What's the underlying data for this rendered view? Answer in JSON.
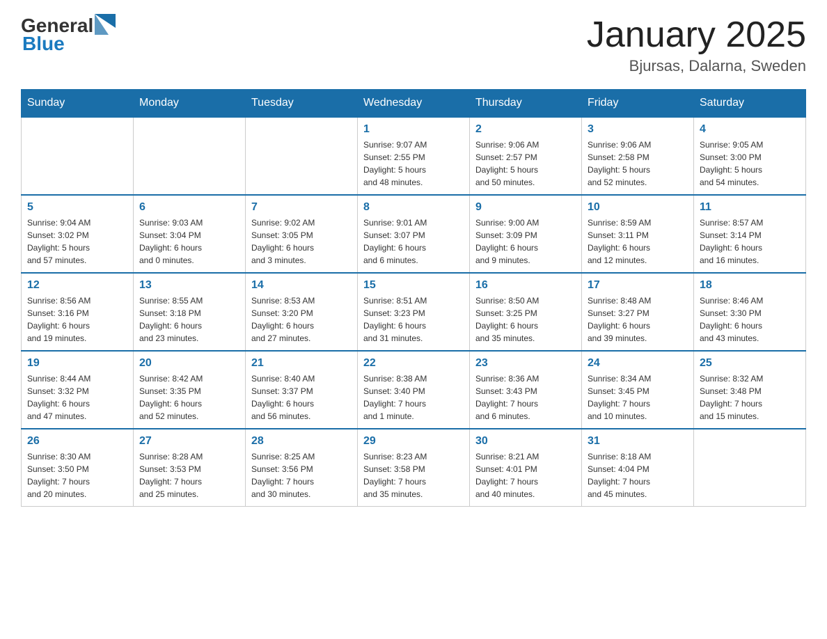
{
  "header": {
    "logo_general": "General",
    "logo_blue": "Blue",
    "title": "January 2025",
    "subtitle": "Bjursas, Dalarna, Sweden"
  },
  "weekdays": [
    "Sunday",
    "Monday",
    "Tuesday",
    "Wednesday",
    "Thursday",
    "Friday",
    "Saturday"
  ],
  "weeks": [
    [
      {
        "day": "",
        "info": ""
      },
      {
        "day": "",
        "info": ""
      },
      {
        "day": "",
        "info": ""
      },
      {
        "day": "1",
        "info": "Sunrise: 9:07 AM\nSunset: 2:55 PM\nDaylight: 5 hours\nand 48 minutes."
      },
      {
        "day": "2",
        "info": "Sunrise: 9:06 AM\nSunset: 2:57 PM\nDaylight: 5 hours\nand 50 minutes."
      },
      {
        "day": "3",
        "info": "Sunrise: 9:06 AM\nSunset: 2:58 PM\nDaylight: 5 hours\nand 52 minutes."
      },
      {
        "day": "4",
        "info": "Sunrise: 9:05 AM\nSunset: 3:00 PM\nDaylight: 5 hours\nand 54 minutes."
      }
    ],
    [
      {
        "day": "5",
        "info": "Sunrise: 9:04 AM\nSunset: 3:02 PM\nDaylight: 5 hours\nand 57 minutes."
      },
      {
        "day": "6",
        "info": "Sunrise: 9:03 AM\nSunset: 3:04 PM\nDaylight: 6 hours\nand 0 minutes."
      },
      {
        "day": "7",
        "info": "Sunrise: 9:02 AM\nSunset: 3:05 PM\nDaylight: 6 hours\nand 3 minutes."
      },
      {
        "day": "8",
        "info": "Sunrise: 9:01 AM\nSunset: 3:07 PM\nDaylight: 6 hours\nand 6 minutes."
      },
      {
        "day": "9",
        "info": "Sunrise: 9:00 AM\nSunset: 3:09 PM\nDaylight: 6 hours\nand 9 minutes."
      },
      {
        "day": "10",
        "info": "Sunrise: 8:59 AM\nSunset: 3:11 PM\nDaylight: 6 hours\nand 12 minutes."
      },
      {
        "day": "11",
        "info": "Sunrise: 8:57 AM\nSunset: 3:14 PM\nDaylight: 6 hours\nand 16 minutes."
      }
    ],
    [
      {
        "day": "12",
        "info": "Sunrise: 8:56 AM\nSunset: 3:16 PM\nDaylight: 6 hours\nand 19 minutes."
      },
      {
        "day": "13",
        "info": "Sunrise: 8:55 AM\nSunset: 3:18 PM\nDaylight: 6 hours\nand 23 minutes."
      },
      {
        "day": "14",
        "info": "Sunrise: 8:53 AM\nSunset: 3:20 PM\nDaylight: 6 hours\nand 27 minutes."
      },
      {
        "day": "15",
        "info": "Sunrise: 8:51 AM\nSunset: 3:23 PM\nDaylight: 6 hours\nand 31 minutes."
      },
      {
        "day": "16",
        "info": "Sunrise: 8:50 AM\nSunset: 3:25 PM\nDaylight: 6 hours\nand 35 minutes."
      },
      {
        "day": "17",
        "info": "Sunrise: 8:48 AM\nSunset: 3:27 PM\nDaylight: 6 hours\nand 39 minutes."
      },
      {
        "day": "18",
        "info": "Sunrise: 8:46 AM\nSunset: 3:30 PM\nDaylight: 6 hours\nand 43 minutes."
      }
    ],
    [
      {
        "day": "19",
        "info": "Sunrise: 8:44 AM\nSunset: 3:32 PM\nDaylight: 6 hours\nand 47 minutes."
      },
      {
        "day": "20",
        "info": "Sunrise: 8:42 AM\nSunset: 3:35 PM\nDaylight: 6 hours\nand 52 minutes."
      },
      {
        "day": "21",
        "info": "Sunrise: 8:40 AM\nSunset: 3:37 PM\nDaylight: 6 hours\nand 56 minutes."
      },
      {
        "day": "22",
        "info": "Sunrise: 8:38 AM\nSunset: 3:40 PM\nDaylight: 7 hours\nand 1 minute."
      },
      {
        "day": "23",
        "info": "Sunrise: 8:36 AM\nSunset: 3:43 PM\nDaylight: 7 hours\nand 6 minutes."
      },
      {
        "day": "24",
        "info": "Sunrise: 8:34 AM\nSunset: 3:45 PM\nDaylight: 7 hours\nand 10 minutes."
      },
      {
        "day": "25",
        "info": "Sunrise: 8:32 AM\nSunset: 3:48 PM\nDaylight: 7 hours\nand 15 minutes."
      }
    ],
    [
      {
        "day": "26",
        "info": "Sunrise: 8:30 AM\nSunset: 3:50 PM\nDaylight: 7 hours\nand 20 minutes."
      },
      {
        "day": "27",
        "info": "Sunrise: 8:28 AM\nSunset: 3:53 PM\nDaylight: 7 hours\nand 25 minutes."
      },
      {
        "day": "28",
        "info": "Sunrise: 8:25 AM\nSunset: 3:56 PM\nDaylight: 7 hours\nand 30 minutes."
      },
      {
        "day": "29",
        "info": "Sunrise: 8:23 AM\nSunset: 3:58 PM\nDaylight: 7 hours\nand 35 minutes."
      },
      {
        "day": "30",
        "info": "Sunrise: 8:21 AM\nSunset: 4:01 PM\nDaylight: 7 hours\nand 40 minutes."
      },
      {
        "day": "31",
        "info": "Sunrise: 8:18 AM\nSunset: 4:04 PM\nDaylight: 7 hours\nand 45 minutes."
      },
      {
        "day": "",
        "info": ""
      }
    ]
  ]
}
